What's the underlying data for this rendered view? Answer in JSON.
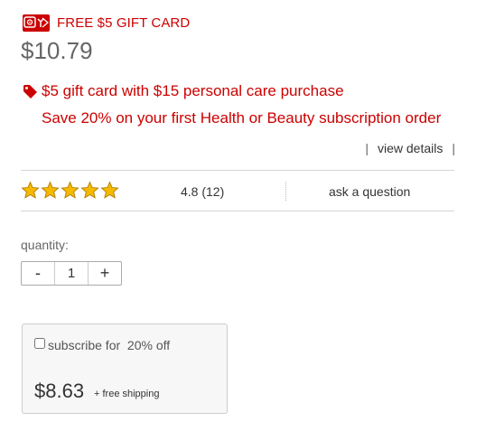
{
  "promo": {
    "badge_text": "FREE $5 GIFT CARD",
    "icon": "gift-card-icon"
  },
  "price": "$10.79",
  "offers": {
    "gift_card": "$5 gift card with $15 personal care purchase",
    "subscription_save": "Save 20% on your first Health or Beauty subscription order",
    "tag_icon": "tag-icon"
  },
  "details": {
    "bar_left": "|",
    "link": "view details",
    "bar_right": "|"
  },
  "rating": {
    "stars": 5,
    "star_icon": "star-icon",
    "value_text": "4.8 (12)",
    "ask_link": "ask a question"
  },
  "quantity": {
    "label": "quantity:",
    "minus": "-",
    "value": "1",
    "plus": "+"
  },
  "subscribe": {
    "label": "subscribe for  20% off",
    "price": "$8.63",
    "shipping": "+ free shipping"
  },
  "colors": {
    "brand_red": "#cc0000",
    "star_gold": "#f5b900",
    "star_outline": "#b07a00",
    "text": "#333333"
  }
}
